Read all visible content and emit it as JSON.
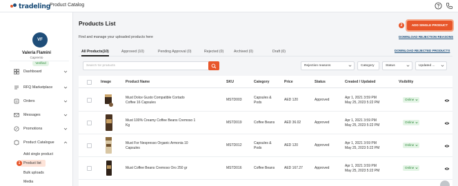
{
  "header": {
    "logo_text": "tradeling",
    "app_title": "Product Catalog",
    "help_icon": "help-circle-icon",
    "phone_icon": "phone-icon"
  },
  "user": {
    "initials": "VF",
    "name": "Valeria Flamini",
    "company": "Caprento",
    "badge": "Verified"
  },
  "sidebar": {
    "items": [
      {
        "label": "Dashboard",
        "icon": "dashboard-icon"
      },
      {
        "label": "RFQ Marketplace",
        "icon": "rfq-icon"
      },
      {
        "label": "Orders",
        "icon": "orders-icon"
      },
      {
        "label": "Messages",
        "icon": "messages-icon"
      },
      {
        "label": "Promotions",
        "icon": "promotions-icon"
      },
      {
        "label": "Product Catalogue",
        "icon": "catalogue-icon"
      }
    ],
    "sub_items": [
      "Add single product",
      "Product list",
      "Bulk uploads",
      "Media"
    ],
    "step1": "1"
  },
  "page": {
    "title": "Products List",
    "subtitle": "Find and manage your uploaded products here",
    "add_button": "ADD SINGLE PRODUCT",
    "step2": "2",
    "download_rejection": "DOWNLOAD REJECTION REASONS",
    "download_rejected": "DOWNLOAD REJECTED PRODUCTS"
  },
  "tabs": [
    "All Products(10)",
    "Approved (10)",
    "Pending Approval (0)",
    "Rejected (0)",
    "Archived (0)",
    "Draft (0)"
  ],
  "search": {
    "placeholder": "Search for products"
  },
  "filters": {
    "rejection": "Rejection reasons",
    "category": "Category",
    "status": "Status",
    "updated": "Updated ..."
  },
  "table": {
    "headers": [
      "Image",
      "Product Name",
      "SKU",
      "Category",
      "Price",
      "Status",
      "Created / Updated",
      "Visibility"
    ],
    "rows": [
      {
        "name": [
          "Must Dolce Gusto Compatible Cortado",
          "Coffee 16 Capsules"
        ],
        "sku": "MSTD003",
        "category": [
          "Capsules &",
          "Pods"
        ],
        "price": "AED 120",
        "status": "Approved",
        "dates": [
          "Apr 1, 2021 3:59 PM",
          "May 25, 2023 5:22 PM"
        ],
        "visibility": "Online"
      },
      {
        "name": [
          "Must 100% Creamy Coffee Beans Cremoso 1",
          "Kg"
        ],
        "sku": "MSTD019",
        "category": [
          "Coffee Beans"
        ],
        "price": "AED 36.02",
        "status": "Approved",
        "dates": [
          "Apr 1, 2021 3:59 PM",
          "May 25, 2023 5:22 PM"
        ],
        "visibility": "Online"
      },
      {
        "name": [
          "Must For Nespresso Organic Armonia 10",
          "Capsules"
        ],
        "sku": "MSTD012",
        "category": [
          "Capsules &",
          "Pods"
        ],
        "price": "AED 120",
        "status": "Approved",
        "dates": [
          "Apr 1, 2021 3:59 PM",
          "May 25, 2023 5:22 PM"
        ],
        "visibility": "Online"
      },
      {
        "name": [
          "Must Coffee Beans Cremoso Oro 250 gr"
        ],
        "sku": "MSTD016",
        "category": [
          "Coffee Beans"
        ],
        "price": "AED 167.27",
        "status": "Approved",
        "dates": [
          "Apr 1, 2021 3:59 PM",
          "May 25, 2023 5:22 PM"
        ],
        "visibility": "Online"
      }
    ]
  },
  "colors": {
    "accent": "#e8562a",
    "brand": "#1d4f7a",
    "online": "#2e8b3a"
  }
}
